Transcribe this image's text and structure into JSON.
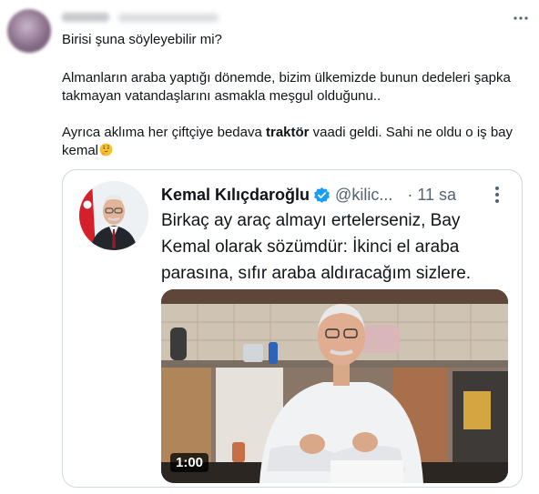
{
  "tweet": {
    "lines": {
      "l1": "Birisi şuna söyleyebilir mi?",
      "l2": "Almanların araba yaptığı dönemde, bizim ülkemizde bunun dedeleri şapka",
      "l3": "takmayan vatandaşlarını asmakla meşgul olduğunu..",
      "l4_pre": "Ayrıca aklıma her çiftçiye bedava ",
      "l4_bold": "traktör",
      "l4_post": " vaadi geldi. Sahi ne oldu o iş bay",
      "l5": "kemal"
    },
    "emoji": "thinking-face"
  },
  "quote": {
    "name": "Kemal Kılıçdaroğlu",
    "handle": "@kilic...",
    "separator": "·",
    "time": "11 sa",
    "lines": [
      "Birkaç ay araç almayı ertelerseniz, Bay",
      "Kemal olarak sözümdür: İkinci el araba",
      "parasına, sıfır araba aldıracağım sizlere."
    ],
    "video": {
      "duration": "1:00"
    }
  },
  "colors": {
    "text": "#0f1419",
    "secondary": "#536471",
    "verified": "#1d9bf0",
    "border": "#cfd9de"
  }
}
